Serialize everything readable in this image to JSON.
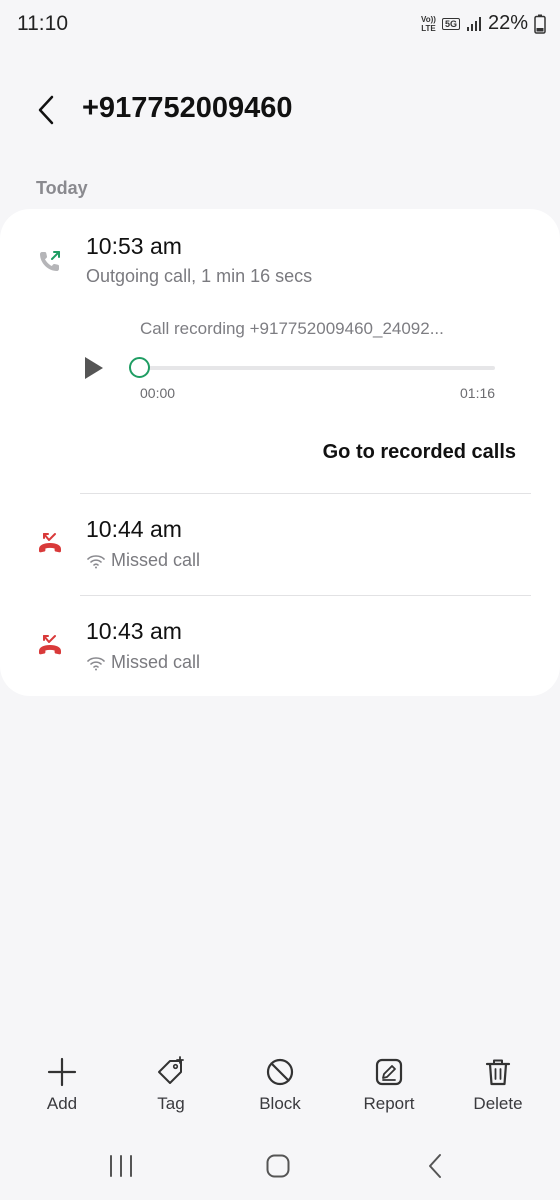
{
  "status_bar": {
    "time": "11:10",
    "volte_top": "Vo))",
    "volte_bottom": "LTE",
    "network": "5G",
    "battery": "22%"
  },
  "header": {
    "title": "+917752009460"
  },
  "section": {
    "label": "Today"
  },
  "calls": [
    {
      "time": "10:53 am",
      "description": "Outgoing call, 1 min 16 secs",
      "type": "outgoing",
      "icon": "outgoing-call-icon",
      "color": "#1f9d63"
    },
    {
      "time": "10:44 am",
      "description": "Missed call",
      "type": "missed",
      "icon": "missed-call-icon",
      "color": "#d93a3a"
    },
    {
      "time": "10:43 am",
      "description": "Missed call",
      "type": "missed",
      "icon": "missed-call-icon",
      "color": "#d93a3a"
    }
  ],
  "recording": {
    "title": "Call recording +917752009460_24092...",
    "start_time": "00:00",
    "end_time": "01:16",
    "progress": 0,
    "accent": "#1f9d63"
  },
  "links": {
    "go_to_recorded": "Go to recorded calls"
  },
  "actions": [
    {
      "label": "Add",
      "icon": "plus-icon"
    },
    {
      "label": "Tag",
      "icon": "tag-icon"
    },
    {
      "label": "Block",
      "icon": "block-icon"
    },
    {
      "label": "Report",
      "icon": "report-icon"
    },
    {
      "label": "Delete",
      "icon": "trash-icon"
    }
  ],
  "nav": [
    {
      "icon": "recent-apps-icon"
    },
    {
      "icon": "home-icon"
    },
    {
      "icon": "back-icon"
    }
  ]
}
